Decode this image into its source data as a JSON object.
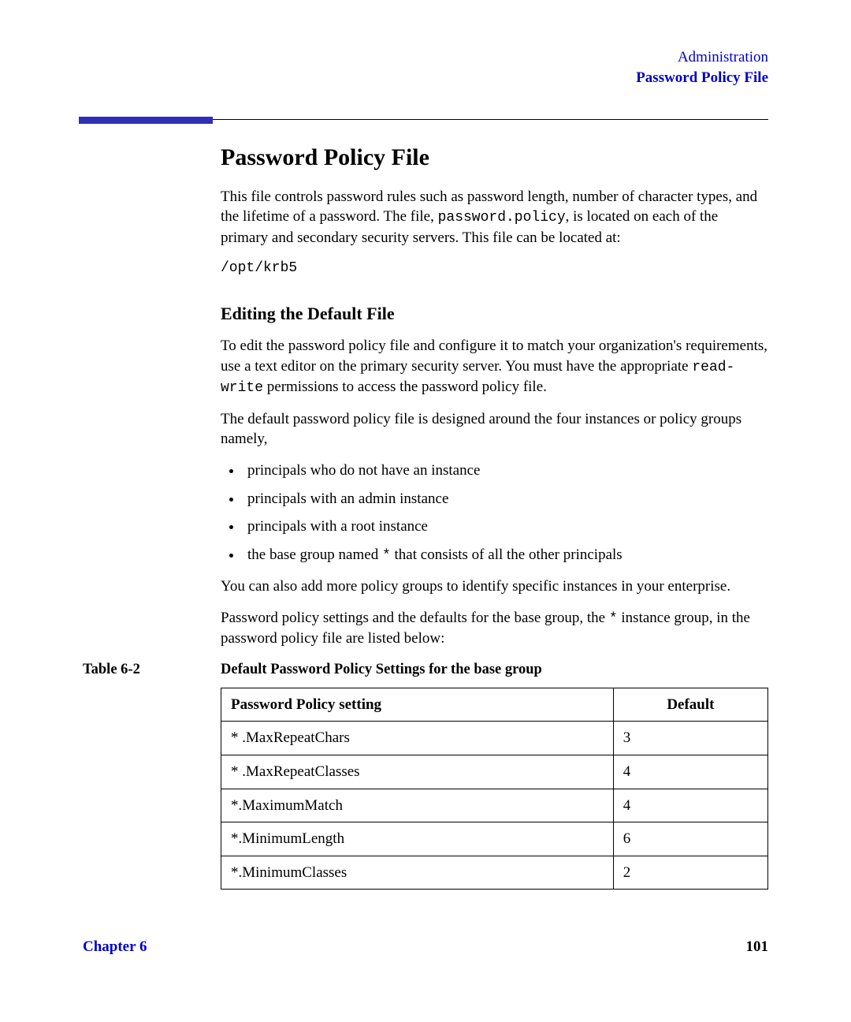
{
  "header": {
    "line1": "Administration",
    "line2": "Password Policy File"
  },
  "title": "Password Policy File",
  "intro": {
    "part1": "This file controls password rules such as password length, number of character types, and the lifetime of a password. The file, ",
    "code": "password.policy",
    "part2": ", is located on each of the primary and secondary security servers. This file can be located at:"
  },
  "path": "/opt/krb5",
  "section2_title": "Editing the Default File",
  "edit_p1": {
    "part1": "To edit the password policy file and configure it to match your organization's requirements, use a text editor on the primary security server. You must have the appropriate ",
    "code": "read-write",
    "part2": " permissions to access the password policy file."
  },
  "edit_p2": "The default password policy file is designed around the four instances or policy groups namely,",
  "bullets": {
    "b1": "principals who do not have an instance",
    "b2": "principals with an admin instance",
    "b3": "principals with a root instance",
    "b4_a": "the base group named ",
    "b4_code": "*",
    "b4_b": " that consists of all the other principals"
  },
  "edit_p3": "You can also add more policy groups to identify specific instances in your enterprise.",
  "edit_p4_a": "Password policy settings and the defaults for the base group, the ",
  "edit_p4_code": "*",
  "edit_p4_b": " instance group, in the password policy file are listed below:",
  "table_label": "Table 6-2",
  "table_caption": "Default Password Policy Settings for the base group",
  "table": {
    "h1": "Password Policy setting",
    "h2": "Default",
    "rows": [
      {
        "setting": "* .MaxRepeatChars",
        "default": "3"
      },
      {
        "setting": "* .MaxRepeatClasses",
        "default": "4"
      },
      {
        "setting": "*.MaximumMatch",
        "default": "4"
      },
      {
        "setting": "*.MinimumLength",
        "default": "6"
      },
      {
        "setting": "*.MinimumClasses",
        "default": "2"
      }
    ]
  },
  "footer": {
    "left": "Chapter 6",
    "right": "101"
  }
}
